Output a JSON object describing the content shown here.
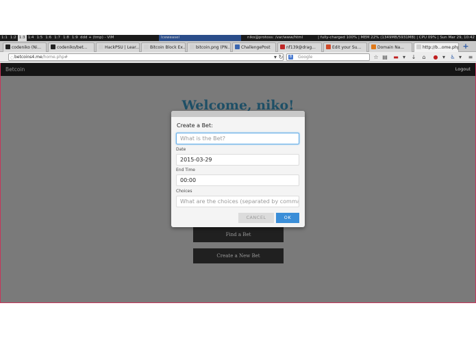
{
  "wm": {
    "workspaces": [
      "1:1",
      "1:2",
      "1:3",
      "1:4",
      "1:5",
      "1:6",
      "1:7",
      "1:8",
      "1:9"
    ],
    "active_workspace": 2,
    "windows": [
      "ddd + (tmp) - VIM",
      "Iceweasel",
      "niko@protoss: /var/www/html"
    ],
    "status": "| fully-charged 100% | MEM 22% (1349MB/5931MB) | CPU 09% | Sun Mar 29, 10:42"
  },
  "tabs": [
    {
      "label": "codeniko (Ni...",
      "fav_color": "#222222"
    },
    {
      "label": "codeniko/bet...",
      "fav_color": "#222222"
    },
    {
      "label": "HackPSU | Lear...",
      "fav_color": "#d0d0d0"
    },
    {
      "label": "Bitcoin Block Ex...",
      "fav_color": "#d0d0d0"
    },
    {
      "label": "bitcoin.png (PN...",
      "fav_color": "#d0d0d0"
    },
    {
      "label": "ChallengePost",
      "fav_color": "#3a66b0"
    },
    {
      "label": "nf139@drag...",
      "fav_color": "#c02828"
    },
    {
      "label": "Edit your Su...",
      "fav_color": "#d04a2a"
    },
    {
      "label": "Domain Na...",
      "fav_color": "#e07a1a"
    },
    {
      "label": "http://b...ome.php",
      "fav_color": "#d0d0d0"
    }
  ],
  "new_tab_label": "+",
  "nav": {
    "url_host": "betcoins4.me",
    "url_path": "/home.php#",
    "search_placeholder": "Google",
    "search_engine_letter": "8"
  },
  "site": {
    "brand": "Betcoin",
    "logout": "Logout",
    "welcome": "Welcome, niko!",
    "find_bet": "Find a Bet",
    "create_bet": "Create a New Bet"
  },
  "modal": {
    "title": "Create a Bet:",
    "bet_placeholder": "What is the Bet?",
    "date_label": "Date",
    "date_value": "2015-03-29",
    "endtime_label": "End Time",
    "endtime_value": "00:00",
    "choices_label": "Choices",
    "choices_placeholder": "What are the choices (separated by commas)",
    "cancel": "CANCEL",
    "ok": "OK"
  },
  "colors": {
    "page_overlay": "#7a7a7a",
    "navbar": "#151515",
    "heading": "#1e4f66",
    "ok_button": "#3b8ed8"
  }
}
